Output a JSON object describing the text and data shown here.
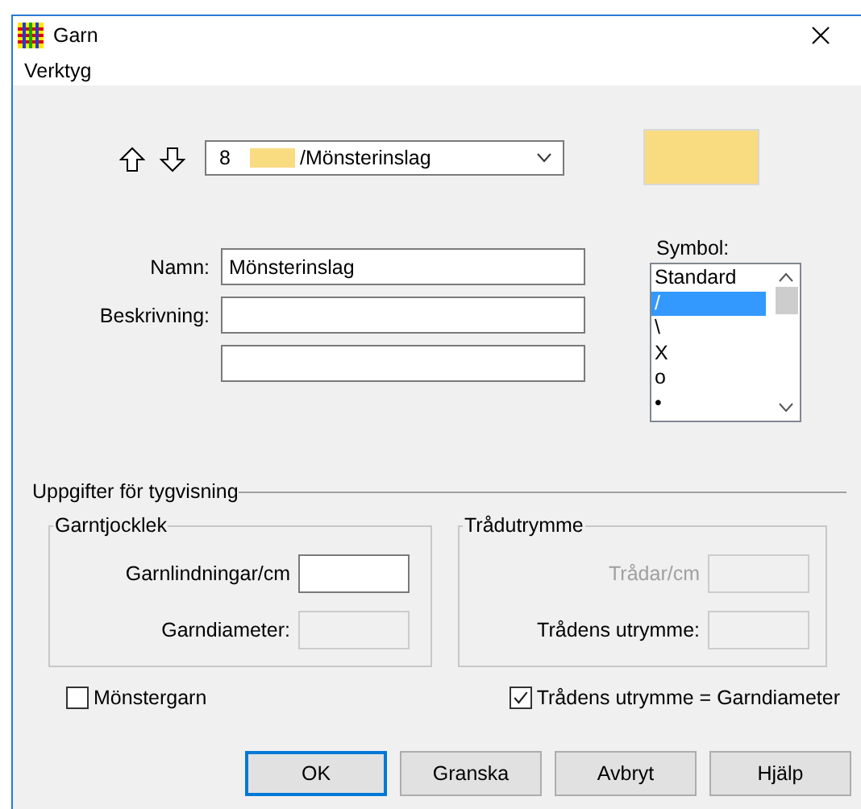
{
  "window": {
    "title": "Garn"
  },
  "menu": [
    {
      "label": "Verktyg"
    }
  ],
  "record": {
    "number": "8",
    "color": "#f9db80",
    "label": "/Mönsterinslag"
  },
  "preview": {
    "color": "#f9db80"
  },
  "fields": [
    {
      "label": "Namn:",
      "value": "Mönsterinslag",
      "disabled": false
    },
    {
      "label": "Beskrivning:",
      "disabled": false
    },
    {
      "disabled": false
    }
  ],
  "symbol": {
    "label": "Symbol:",
    "items": [
      {
        "label": "Standard",
        "selected": false
      },
      {
        "label": "/",
        "selected": true
      },
      {
        "label": "\\",
        "selected": false
      },
      {
        "label": "X",
        "selected": false
      },
      {
        "label": "o",
        "selected": false
      },
      {
        "label": "•",
        "selected": false
      }
    ]
  },
  "section": {
    "title": "Uppgifter för tygvisning"
  },
  "groups": [
    {
      "title": "Garntjocklek",
      "fields": [
        {
          "label": "Garnlindningar/cm",
          "label_disabled": false,
          "disabled": false
        },
        {
          "label": "Garndiameter:",
          "label_disabled": false,
          "disabled": true
        }
      ]
    },
    {
      "title": "Trådutrymme",
      "fields": [
        {
          "label": "Trådar/cm",
          "label_disabled": true,
          "disabled": true
        },
        {
          "label": "Trådens utrymme:",
          "label_disabled": false,
          "disabled": true
        }
      ]
    }
  ],
  "checkboxes": [
    {
      "label": "Mönstergarn",
      "checked": false
    },
    {
      "label": "Trådens utrymme = Garndiameter",
      "checked": true
    }
  ],
  "buttons": [
    {
      "label": "OK",
      "default": true
    },
    {
      "label": "Granska",
      "default": false
    },
    {
      "label": "Avbryt",
      "default": false
    },
    {
      "label": "Hjälp",
      "default": false
    }
  ]
}
